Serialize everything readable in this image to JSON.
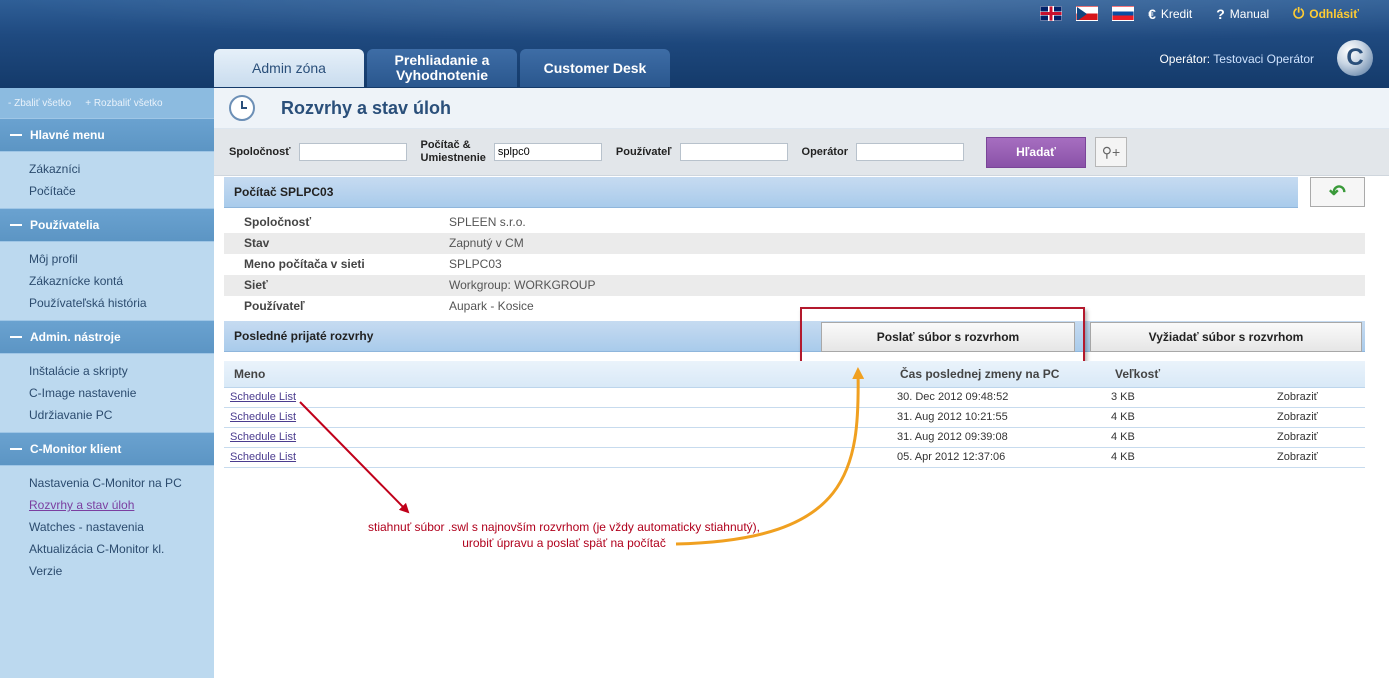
{
  "header": {
    "languages": [
      "English",
      "Čeština",
      "Slovenčina"
    ],
    "links": {
      "credit": "Kredit",
      "manual": "Manual",
      "logout": "Odhlásiť"
    },
    "tabs": [
      {
        "label": "Admin zóna",
        "active": true
      },
      {
        "label": "Prehliadanie a Vyhodnotenie",
        "active": false
      },
      {
        "label": "Customer Desk",
        "active": false
      }
    ],
    "operator_label": "Operátor:",
    "operator_name": "Testovaci Operátor",
    "logo_letter": "C"
  },
  "sidebar": {
    "collapse_all": "- Zbaliť všetko",
    "expand_all": "+ Rozbaliť všetko",
    "sections": [
      {
        "title": "Hlavné menu",
        "items": [
          "Zákazníci",
          "Počítače"
        ]
      },
      {
        "title": "Používatelia",
        "items": [
          "Môj profil",
          "Zákaznícke kontá",
          "Používateľská história"
        ]
      },
      {
        "title": "Admin. nástroje",
        "items": [
          "Inštalácie a skripty",
          "C-Image nastavenie",
          "Udržiavanie PC"
        ]
      },
      {
        "title": "C-Monitor klient",
        "items": [
          "Nastavenia C-Monitor na PC",
          "Rozvrhy a stav úloh",
          "Watches - nastavenia",
          "Aktualizácia C-Monitor kl.",
          "Verzie"
        ]
      }
    ],
    "current_item": "Rozvrhy a stav úloh"
  },
  "page": {
    "title": "Rozvrhy a stav úloh",
    "search": {
      "company_label": "Spoločnosť",
      "company_value": "",
      "computer_label_1": "Počítač &",
      "computer_label_2": "Umiestnenie",
      "computer_value": "splpc0",
      "user_label": "Používateľ",
      "user_value": "",
      "operator_label": "Operátor",
      "operator_value": "",
      "search_button": "Hľadať"
    },
    "computer_section": {
      "title": "Počítač SPLPC03",
      "rows": [
        {
          "label": "Spoločnosť",
          "value": "SPLEEN s.r.o."
        },
        {
          "label": "Stav",
          "value": "Zapnutý v CM"
        },
        {
          "label": "Meno počítača v sieti",
          "value": "SPLPC03"
        },
        {
          "label": "Sieť",
          "value": "Workgroup: WORKGROUP"
        },
        {
          "label": "Používateľ",
          "value": "Aupark - Kosice"
        }
      ]
    },
    "schedules_section": {
      "title": "Posledné prijaté rozvrhy",
      "send_button": "Poslať súbor s rozvrhom",
      "request_button": "Vyžiadať súbor s rozvrhom",
      "columns": [
        "Meno",
        "Čas poslednej zmeny na PC",
        "Veľkosť"
      ],
      "rows": [
        {
          "name": "Schedule List",
          "time": "30. Dec 2012 09:48:52",
          "size": "3 KB",
          "action": "Zobraziť"
        },
        {
          "name": "Schedule List",
          "time": "31. Aug 2012 10:21:55",
          "size": "4 KB",
          "action": "Zobraziť"
        },
        {
          "name": "Schedule List",
          "time": "31. Aug 2012 09:39:08",
          "size": "4 KB",
          "action": "Zobraziť"
        },
        {
          "name": "Schedule List",
          "time": "05. Apr 2012 12:37:06",
          "size": "4 KB",
          "action": "Zobraziť"
        }
      ]
    },
    "annotation": {
      "line1": "stiahnuť súbor .swl s najnovším rozvrhom (je vždy automaticky stiahnutý),",
      "line2": "urobiť úpravu a poslať späť na počítač"
    }
  },
  "colors": {
    "header_blue": "#1f4a80",
    "sidebar_blue": "#7aaed8",
    "search_purple": "#9a5fb6",
    "annotation_red": "#b0001c",
    "arrow_orange": "#f0a020"
  }
}
